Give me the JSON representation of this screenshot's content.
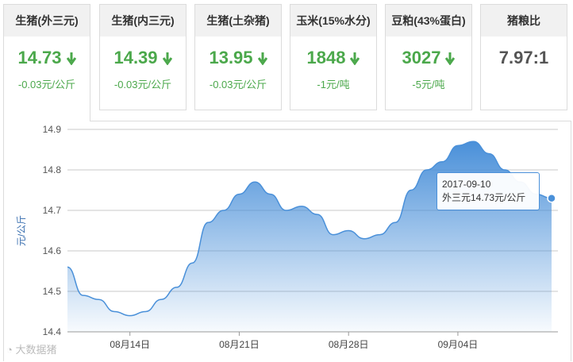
{
  "cards": [
    {
      "title": "生猪(外三元)",
      "value": "14.73",
      "change": "-0.03元/公斤",
      "trend": "down"
    },
    {
      "title": "生猪(内三元)",
      "value": "14.39",
      "change": "-0.03元/公斤",
      "trend": "down"
    },
    {
      "title": "生猪(土杂猪)",
      "value": "13.95",
      "change": "-0.03元/公斤",
      "trend": "down"
    },
    {
      "title": "玉米(15%水分)",
      "value": "1848",
      "change": "-1元/吨",
      "trend": "down"
    },
    {
      "title": "豆粕(43%蛋白)",
      "value": "3027",
      "change": "-5元/吨",
      "trend": "down"
    },
    {
      "title": "猪粮比",
      "value": "7.97:1",
      "change": "",
      "trend": "none"
    }
  ],
  "colors": {
    "down": "#4ba84b",
    "series": "#4a90d9"
  },
  "tooltip": {
    "date": "2017-09-10",
    "text": "外三元14.73元/公斤"
  },
  "watermark": "大数据猪",
  "chart_data": {
    "type": "area",
    "ylabel": "元/公斤",
    "ylim": [
      14.4,
      14.9
    ],
    "yticks": [
      14.4,
      14.5,
      14.6,
      14.7,
      14.8,
      14.9
    ],
    "x_tick_labels": [
      "08月14日",
      "08月21日",
      "08月28日",
      "09月04日"
    ],
    "x": [
      "08-10",
      "08-11",
      "08-12",
      "08-13",
      "08-14",
      "08-15",
      "08-16",
      "08-17",
      "08-18",
      "08-19",
      "08-20",
      "08-21",
      "08-22",
      "08-23",
      "08-24",
      "08-25",
      "08-26",
      "08-27",
      "08-28",
      "08-29",
      "08-30",
      "08-31",
      "09-01",
      "09-02",
      "09-03",
      "09-04",
      "09-05",
      "09-06",
      "09-07",
      "09-08",
      "09-09",
      "09-10"
    ],
    "series": [
      {
        "values": [
          14.56,
          14.49,
          14.48,
          14.45,
          14.44,
          14.45,
          14.48,
          14.51,
          14.57,
          14.67,
          14.7,
          14.74,
          14.77,
          14.74,
          14.7,
          14.71,
          14.69,
          14.64,
          14.65,
          14.63,
          14.64,
          14.67,
          14.75,
          14.8,
          14.82,
          14.86,
          14.87,
          14.84,
          14.8,
          14.77,
          14.74,
          14.73
        ]
      }
    ],
    "grid": true,
    "highlight": "09-10"
  }
}
